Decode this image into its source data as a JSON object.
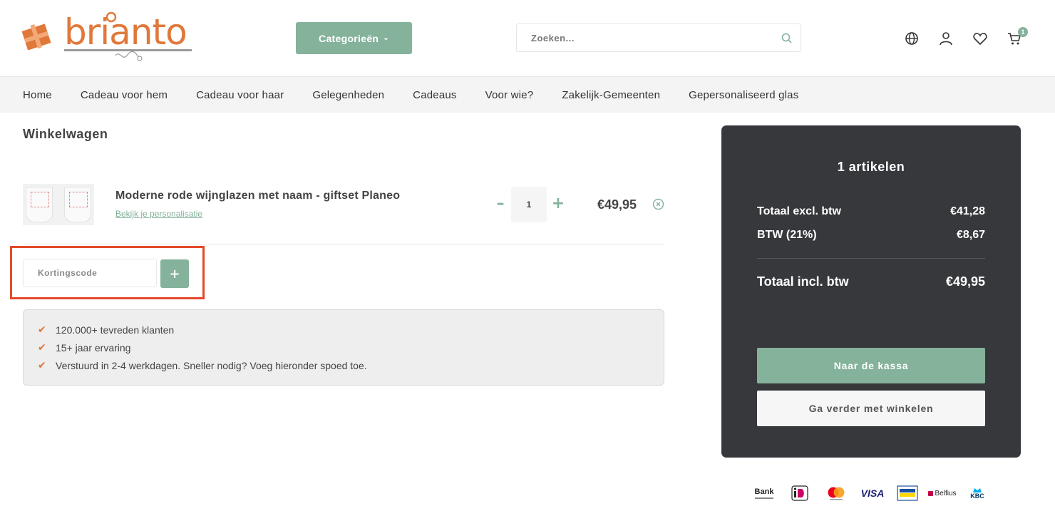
{
  "brand": {
    "name": "brianto",
    "accent": "#e0783a",
    "green": "#84b29b"
  },
  "header": {
    "categories_label": "Categorieën",
    "search_placeholder": "Zoeken...",
    "cart_count": "1"
  },
  "nav": {
    "items": [
      "Home",
      "Cadeau voor hem",
      "Cadeau voor haar",
      "Gelegenheden",
      "Cadeaus",
      "Voor wie?",
      "Zakelijk-Gemeenten",
      "Gepersonaliseerd glas"
    ]
  },
  "cart": {
    "title": "Winkelwagen",
    "item": {
      "name": "Moderne rode wijnglazen met naam - giftset Planeo",
      "link": "Bekijk je personalisatie",
      "quantity": "1",
      "price": "€49,95"
    },
    "discount_placeholder": "Kortingscode",
    "discount_button": "+"
  },
  "usps": [
    "120.000+ tevreden klanten",
    "15+ jaar ervaring",
    "Verstuurd in 2-4 werkdagen. Sneller nodig? Voeg hieronder spoed toe."
  ],
  "summary": {
    "title": "1 artikelen",
    "excl_label": "Totaal excl. btw",
    "excl_value": "€41,28",
    "btw_label": "BTW (21%)",
    "btw_value": "€8,67",
    "incl_label": "Totaal incl. btw",
    "incl_value": "€49,95",
    "checkout": "Naar de kassa",
    "continue": "Ga verder met winkelen"
  },
  "payments": {
    "bank": "Bank",
    "visa": "VISA",
    "belfius": "Belfius",
    "kbc": "KBC",
    "icons": [
      "bank-transfer-icon",
      "ideal-icon",
      "mastercard-icon",
      "visa-icon",
      "bancontact-icon",
      "belfius-icon",
      "kbc-icon"
    ]
  }
}
